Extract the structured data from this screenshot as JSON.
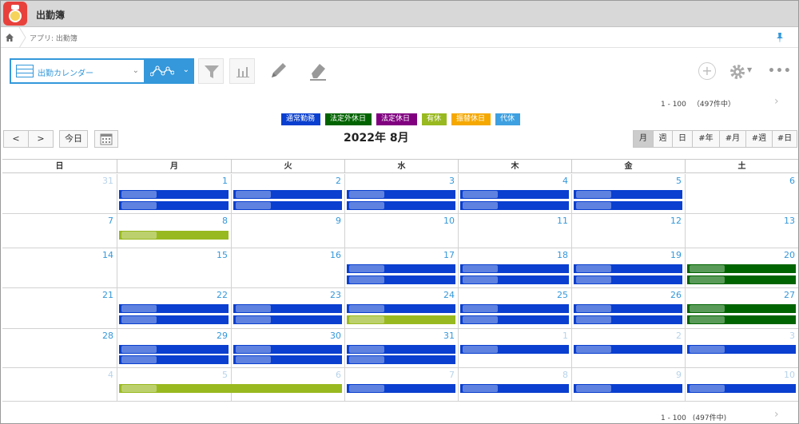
{
  "app": {
    "title": "出勤簿"
  },
  "breadcrumb": {
    "text": "アプリ: 出勤簿"
  },
  "toolbar": {
    "view_label": "出勤カレンダー"
  },
  "pager": {
    "range": "1 - 100",
    "total": "（497件中）",
    "total_bottom": "(497件中)"
  },
  "legend": [
    {
      "label": "通常勤務",
      "color": "#0a3fcf"
    },
    {
      "label": "法定外休日",
      "color": "#006400"
    },
    {
      "label": "法定休日",
      "color": "#800080"
    },
    {
      "label": "有休",
      "color": "#99b920"
    },
    {
      "label": "振替休日",
      "color": "#f5a800"
    },
    {
      "label": "代休",
      "color": "#3ea0e0"
    }
  ],
  "calendar": {
    "prev": "<",
    "next": ">",
    "today": "今日",
    "title": "2022年 8月",
    "modes": [
      "月",
      "週",
      "日",
      "#年",
      "#月",
      "#週",
      "#日"
    ],
    "weekdays": [
      "日",
      "月",
      "火",
      "水",
      "木",
      "金",
      "土"
    ],
    "weeks": [
      [
        "31",
        "1",
        "2",
        "3",
        "4",
        "5",
        "6"
      ],
      [
        "7",
        "8",
        "9",
        "10",
        "11",
        "12",
        "13"
      ],
      [
        "14",
        "15",
        "16",
        "17",
        "18",
        "19",
        "20"
      ],
      [
        "21",
        "22",
        "23",
        "24",
        "25",
        "26",
        "27"
      ],
      [
        "28",
        "29",
        "30",
        "31",
        "1",
        "2",
        "3"
      ],
      [
        "4",
        "5",
        "6",
        "7",
        "8",
        "9",
        "10"
      ]
    ]
  }
}
